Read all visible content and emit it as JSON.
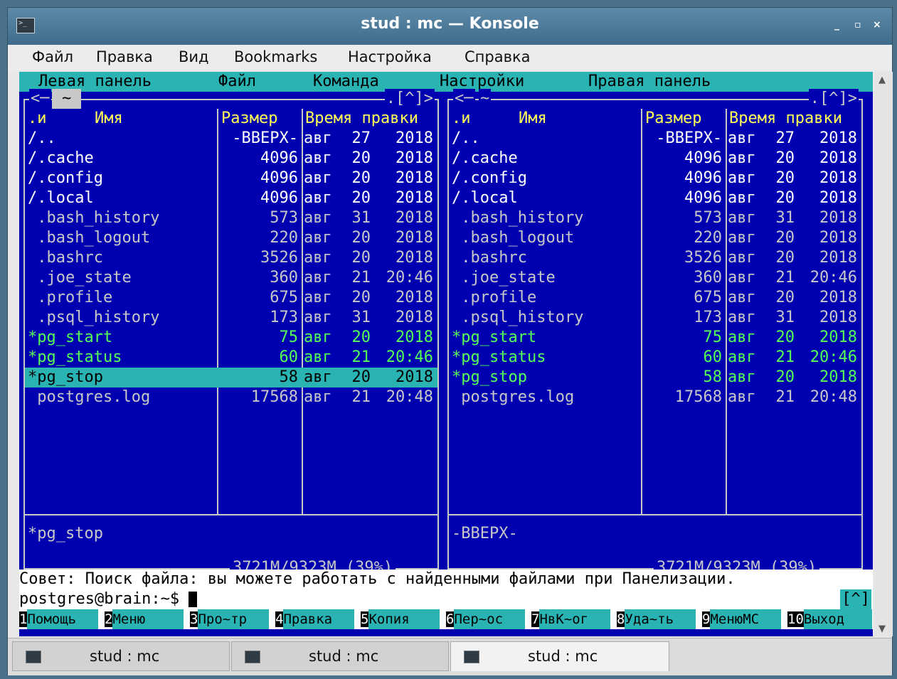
{
  "window": {
    "title": "stud : mc — Konsole",
    "btn_min": "_",
    "btn_max": "▫",
    "btn_close": "×"
  },
  "menubar": [
    "Файл",
    "Правка",
    "Вид",
    "Bookmarks",
    "Настройка",
    "Справка"
  ],
  "mc_menu": [
    "Левая панель",
    "Файл",
    "Команда",
    "Настройки",
    "Правая панель"
  ],
  "left_panel": {
    "path_label": "~",
    "left_arrow": "<─",
    "right_arrows": ".[^]>",
    "headers": {
      "flag": ".и",
      "name": "Имя",
      "size": "Размер",
      "time": "Время правки"
    },
    "files": [
      {
        "name": "/..",
        "size": "-ВВЕРХ-",
        "month": "авг",
        "day": "27",
        "time": "2018",
        "kind": "dir"
      },
      {
        "name": "/.cache",
        "size": "4096",
        "month": "авг",
        "day": "20",
        "time": "2018",
        "kind": "dir"
      },
      {
        "name": "/.config",
        "size": "4096",
        "month": "авг",
        "day": "20",
        "time": "2018",
        "kind": "dir"
      },
      {
        "name": "/.local",
        "size": "4096",
        "month": "авг",
        "day": "20",
        "time": "2018",
        "kind": "dir"
      },
      {
        "name": " .bash_history",
        "size": "573",
        "month": "авг",
        "day": "31",
        "time": "2018",
        "kind": "file"
      },
      {
        "name": " .bash_logout",
        "size": "220",
        "month": "авг",
        "day": "20",
        "time": "2018",
        "kind": "file"
      },
      {
        "name": " .bashrc",
        "size": "3526",
        "month": "авг",
        "day": "20",
        "time": "2018",
        "kind": "file"
      },
      {
        "name": " .joe_state",
        "size": "360",
        "month": "авг",
        "day": "21",
        "time": "20:46",
        "kind": "file"
      },
      {
        "name": " .profile",
        "size": "675",
        "month": "авг",
        "day": "20",
        "time": "2018",
        "kind": "file"
      },
      {
        "name": " .psql_history",
        "size": "173",
        "month": "авг",
        "day": "31",
        "time": "2018",
        "kind": "file"
      },
      {
        "name": "*pg_start",
        "size": "75",
        "month": "авг",
        "day": "20",
        "time": "2018",
        "kind": "exe"
      },
      {
        "name": "*pg_status",
        "size": "60",
        "month": "авг",
        "day": "21",
        "time": "20:46",
        "kind": "exe"
      },
      {
        "name": "*pg_stop",
        "size": "58",
        "month": "авг",
        "day": "20",
        "time": "2018",
        "kind": "selected"
      },
      {
        "name": " postgres.log",
        "size": "17568",
        "month": "авг",
        "day": "21",
        "time": "20:48",
        "kind": "file"
      }
    ],
    "status": "*pg_stop",
    "free": "3721M/9323M (39%)"
  },
  "right_panel": {
    "path_label": "~",
    "left_arrow": "<─",
    "right_arrows": ".[^]>",
    "headers": {
      "flag": ".и",
      "name": "Имя",
      "size": "Размер",
      "time": "Время правки"
    },
    "files": [
      {
        "name": "/..",
        "size": "-ВВЕРХ-",
        "month": "авг",
        "day": "27",
        "time": "2018",
        "kind": "dir"
      },
      {
        "name": "/.cache",
        "size": "4096",
        "month": "авг",
        "day": "20",
        "time": "2018",
        "kind": "dir"
      },
      {
        "name": "/.config",
        "size": "4096",
        "month": "авг",
        "day": "20",
        "time": "2018",
        "kind": "dir"
      },
      {
        "name": "/.local",
        "size": "4096",
        "month": "авг",
        "day": "20",
        "time": "2018",
        "kind": "dir"
      },
      {
        "name": " .bash_history",
        "size": "573",
        "month": "авг",
        "day": "31",
        "time": "2018",
        "kind": "file"
      },
      {
        "name": " .bash_logout",
        "size": "220",
        "month": "авг",
        "day": "20",
        "time": "2018",
        "kind": "file"
      },
      {
        "name": " .bashrc",
        "size": "3526",
        "month": "авг",
        "day": "20",
        "time": "2018",
        "kind": "file"
      },
      {
        "name": " .joe_state",
        "size": "360",
        "month": "авг",
        "day": "21",
        "time": "20:46",
        "kind": "file"
      },
      {
        "name": " .profile",
        "size": "675",
        "month": "авг",
        "day": "20",
        "time": "2018",
        "kind": "file"
      },
      {
        "name": " .psql_history",
        "size": "173",
        "month": "авг",
        "day": "31",
        "time": "2018",
        "kind": "file"
      },
      {
        "name": "*pg_start",
        "size": "75",
        "month": "авг",
        "day": "20",
        "time": "2018",
        "kind": "exe"
      },
      {
        "name": "*pg_status",
        "size": "60",
        "month": "авг",
        "day": "21",
        "time": "20:46",
        "kind": "exe"
      },
      {
        "name": "*pg_stop",
        "size": "58",
        "month": "авг",
        "day": "20",
        "time": "2018",
        "kind": "exe"
      },
      {
        "name": " postgres.log",
        "size": "17568",
        "month": "авг",
        "day": "21",
        "time": "20:48",
        "kind": "file"
      }
    ],
    "status": "-ВВЕРХ-",
    "free": "3721M/9323M (39%)"
  },
  "tip": "Совет: Поиск файла: вы можете работать с найденными файлами при Панелизации.",
  "prompt": "postgres@brain:~$ ",
  "history_btn": "[^]",
  "fkeys": [
    {
      "num": "1",
      "label": "Помощь"
    },
    {
      "num": "2",
      "label": "Меню"
    },
    {
      "num": "3",
      "label": "Про~тр"
    },
    {
      "num": "4",
      "label": "Правка"
    },
    {
      "num": "5",
      "label": "Копия"
    },
    {
      "num": "6",
      "label": "Пер~ос"
    },
    {
      "num": "7",
      "label": "НвК~ог"
    },
    {
      "num": "8",
      "label": "Уда~ть"
    },
    {
      "num": "9",
      "label": "МенюМС"
    },
    {
      "num": "10",
      "label": "Выход"
    }
  ],
  "tabs": [
    {
      "label": "stud : mc",
      "active": false
    },
    {
      "label": "stud : mc",
      "active": false
    },
    {
      "label": "stud : mc",
      "active": true
    }
  ],
  "colors": {
    "terminal_bg": "#0000b0",
    "accent_cyan": "#2ab3b3",
    "header_yellow": "#ffff55",
    "exe_green": "#55ff55"
  }
}
